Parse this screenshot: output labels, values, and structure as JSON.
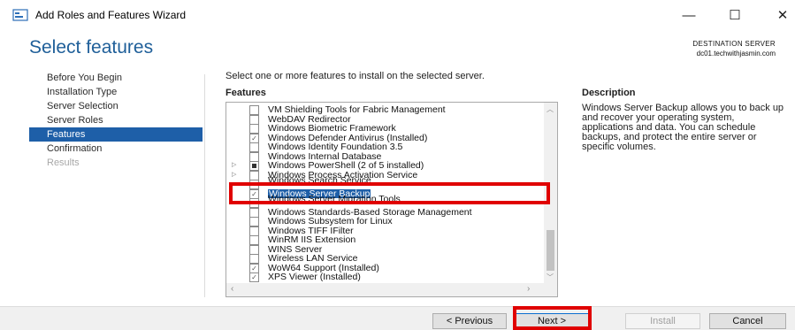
{
  "window": {
    "title": "Add Roles and Features Wizard",
    "controls": [
      "—",
      "☐",
      "✕"
    ]
  },
  "header": {
    "title": "Select features",
    "dest_label": "DESTINATION SERVER",
    "dest_server": "dc01.techwithjasmin.com"
  },
  "nav": {
    "items": [
      {
        "label": "Before You Begin",
        "state": "normal"
      },
      {
        "label": "Installation Type",
        "state": "normal"
      },
      {
        "label": "Server Selection",
        "state": "normal"
      },
      {
        "label": "Server Roles",
        "state": "normal"
      },
      {
        "label": "Features",
        "state": "active"
      },
      {
        "label": "Confirmation",
        "state": "normal"
      },
      {
        "label": "Results",
        "state": "disabled"
      }
    ]
  },
  "main": {
    "instructions": "Select one or more features to install on the selected server.",
    "features_label": "Features",
    "features": [
      {
        "label": "VM Shielding Tools for Fabric Management",
        "checked": false,
        "expander": false
      },
      {
        "label": "WebDAV Redirector",
        "checked": false,
        "expander": false
      },
      {
        "label": "Windows Biometric Framework",
        "checked": false,
        "expander": false
      },
      {
        "label": "Windows Defender Antivirus (Installed)",
        "checked": true,
        "expander": false
      },
      {
        "label": "Windows Identity Foundation 3.5",
        "checked": false,
        "expander": false
      },
      {
        "label": "Windows Internal Database",
        "checked": false,
        "expander": false
      },
      {
        "label": "Windows PowerShell (2 of 5 installed)",
        "checked": "partial",
        "expander": true
      },
      {
        "label": "Windows Process Activation Service",
        "checked": false,
        "expander": true
      },
      {
        "label": "Windows Search Service",
        "checked": false,
        "expander": false,
        "cut": true
      },
      {
        "label": "Windows Server Backup",
        "checked": true,
        "expander": false,
        "selected": true
      },
      {
        "label": "Windows Server Migration Tools",
        "checked": false,
        "expander": false,
        "cut": true
      },
      {
        "label": "Windows Standards-Based Storage Management",
        "checked": false,
        "expander": false
      },
      {
        "label": "Windows Subsystem for Linux",
        "checked": false,
        "expander": false
      },
      {
        "label": "Windows TIFF IFilter",
        "checked": false,
        "expander": false
      },
      {
        "label": "WinRM IIS Extension",
        "checked": false,
        "expander": false
      },
      {
        "label": "WINS Server",
        "checked": false,
        "expander": false
      },
      {
        "label": "Wireless LAN Service",
        "checked": false,
        "expander": false
      },
      {
        "label": "WoW64 Support (Installed)",
        "checked": true,
        "expander": false
      },
      {
        "label": "XPS Viewer (Installed)",
        "checked": true,
        "expander": false
      }
    ]
  },
  "description": {
    "heading": "Description",
    "text": "Windows Server Backup allows you to back up and recover your operating system, applications and data. You can schedule backups, and protect the entire server or specific volumes."
  },
  "buttons": {
    "previous": "< Previous",
    "next": "Next >",
    "install": "Install",
    "cancel": "Cancel"
  },
  "colors": {
    "accent": "#1e5fa8",
    "heading": "#1f5f99",
    "highlight": "#e00000"
  }
}
